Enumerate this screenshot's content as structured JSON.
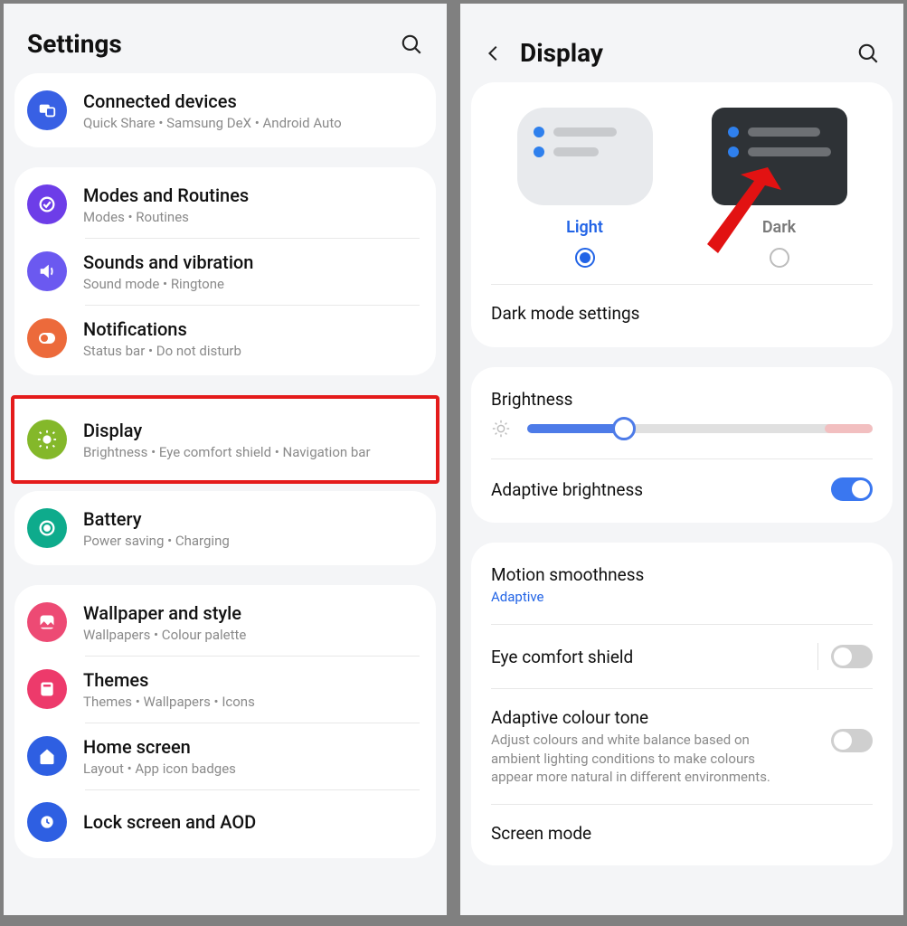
{
  "left": {
    "title": "Settings",
    "group0": {
      "connected": {
        "title": "Connected devices",
        "sub": "Quick Share  •  Samsung DeX  •  Android Auto"
      }
    },
    "group1": {
      "modes": {
        "title": "Modes and Routines",
        "sub": "Modes  •  Routines"
      },
      "sounds": {
        "title": "Sounds and vibration",
        "sub": "Sound mode  •  Ringtone"
      },
      "notifications": {
        "title": "Notifications",
        "sub": "Status bar  •  Do not disturb"
      }
    },
    "display": {
      "title": "Display",
      "sub": "Brightness  •  Eye comfort shield  •  Navigation bar"
    },
    "group2": {
      "battery": {
        "title": "Battery",
        "sub": "Power saving  •  Charging"
      }
    },
    "group3": {
      "wallpaper": {
        "title": "Wallpaper and style",
        "sub": "Wallpapers  •  Colour palette"
      },
      "themes": {
        "title": "Themes",
        "sub": "Themes  •  Wallpapers  •  Icons"
      },
      "home": {
        "title": "Home screen",
        "sub": "Layout  •  App icon badges"
      },
      "lock": {
        "title": "Lock screen and AOD",
        "sub": ""
      }
    }
  },
  "right": {
    "title": "Display",
    "theme": {
      "light": "Light",
      "dark": "Dark"
    },
    "darkmode_settings": "Dark mode settings",
    "brightness": {
      "label": "Brightness",
      "value_pct": 28,
      "warn_tail_pct": 14
    },
    "adaptive_brightness": {
      "label": "Adaptive brightness",
      "on": true
    },
    "motion": {
      "label": "Motion smoothness",
      "sub": "Adaptive"
    },
    "eyecomfort": {
      "label": "Eye comfort shield",
      "on": false
    },
    "colortone": {
      "label": "Adaptive colour tone",
      "sub": "Adjust colours and white balance based on ambient lighting conditions to make colours appear more natural in different environments.",
      "on": false
    },
    "screenmode": {
      "label": "Screen mode"
    }
  },
  "colors": {
    "connected": "#3860e4",
    "modes": "#6d3de8",
    "sounds": "#6b59f0",
    "notifications": "#ec6a3b",
    "display": "#84b82a",
    "battery": "#0eab8c",
    "wallpaper": "#ed4a74",
    "themes": "#ed3a6b",
    "home": "#2e5fe2",
    "lock": "#2e5fe2"
  }
}
